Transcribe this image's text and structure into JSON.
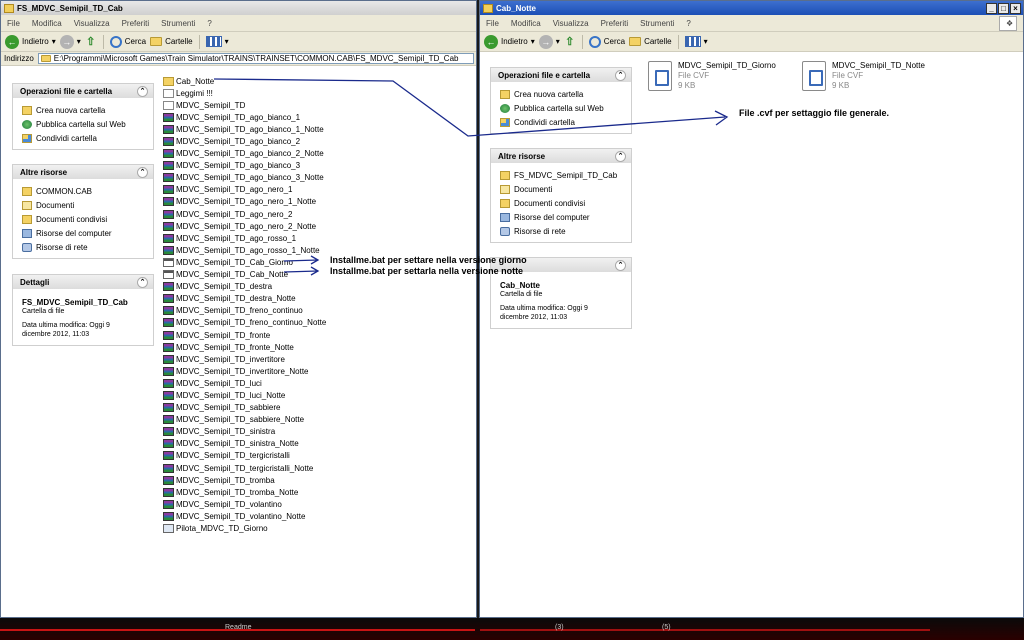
{
  "left_window": {
    "title": "FS_MDVC_Semipil_TD_Cab",
    "menu": [
      "File",
      "Modifica",
      "Visualizza",
      "Preferiti",
      "Strumenti",
      "?"
    ],
    "toolbar": {
      "back": "Indietro",
      "search": "Cerca",
      "folders": "Cartelle"
    },
    "address_label": "Indirizzo",
    "address": "E:\\Programmi\\Microsoft Games\\Train Simulator\\TRAINS\\TRAINSET\\COMMON.CAB\\FS_MDVC_Semipil_TD_Cab",
    "tasks": {
      "title": "Operazioni file e cartella",
      "items": [
        "Crea nuova cartella",
        "Pubblica cartella sul Web",
        "Condividi cartella"
      ]
    },
    "other": {
      "title": "Altre risorse",
      "items": [
        "COMMON.CAB",
        "Documenti",
        "Documenti condivisi",
        "Risorse del computer",
        "Risorse di rete"
      ]
    },
    "details": {
      "title": "Dettagli",
      "name": "FS_MDVC_Semipil_TD_Cab",
      "type": "Cartella di file",
      "modified_1": "Data ultima modifica: Oggi 9",
      "modified_2": "dicembre 2012, 11:03"
    },
    "files": [
      {
        "name": "Cab_Notte",
        "type": "folder"
      },
      {
        "name": "Leggimi !!!",
        "type": "txt"
      },
      {
        "name": "MDVC_Semipil_TD",
        "type": "txt"
      },
      {
        "name": "MDVC_Semipil_TD_ago_bianco_1",
        "type": "rar"
      },
      {
        "name": "MDVC_Semipil_TD_ago_bianco_1_Notte",
        "type": "rar"
      },
      {
        "name": "MDVC_Semipil_TD_ago_bianco_2",
        "type": "rar"
      },
      {
        "name": "MDVC_Semipil_TD_ago_bianco_2_Notte",
        "type": "rar"
      },
      {
        "name": "MDVC_Semipil_TD_ago_bianco_3",
        "type": "rar"
      },
      {
        "name": "MDVC_Semipil_TD_ago_bianco_3_Notte",
        "type": "rar"
      },
      {
        "name": "MDVC_Semipil_TD_ago_nero_1",
        "type": "rar"
      },
      {
        "name": "MDVC_Semipil_TD_ago_nero_1_Notte",
        "type": "rar"
      },
      {
        "name": "MDVC_Semipil_TD_ago_nero_2",
        "type": "rar"
      },
      {
        "name": "MDVC_Semipil_TD_ago_nero_2_Notte",
        "type": "rar"
      },
      {
        "name": "MDVC_Semipil_TD_ago_rosso_1",
        "type": "rar"
      },
      {
        "name": "MDVC_Semipil_TD_ago_rosso_1_Notte",
        "type": "rar"
      },
      {
        "name": "MDVC_Semipil_TD_Cab_Giorno",
        "type": "bat"
      },
      {
        "name": "MDVC_Semipil_TD_Cab_Notte",
        "type": "bat"
      },
      {
        "name": "MDVC_Semipil_TD_destra",
        "type": "rar"
      },
      {
        "name": "MDVC_Semipil_TD_destra_Notte",
        "type": "rar"
      },
      {
        "name": "MDVC_Semipil_TD_freno_continuo",
        "type": "rar"
      },
      {
        "name": "MDVC_Semipil_TD_freno_continuo_Notte",
        "type": "rar"
      },
      {
        "name": "MDVC_Semipil_TD_fronte",
        "type": "rar"
      },
      {
        "name": "MDVC_Semipil_TD_fronte_Notte",
        "type": "rar"
      },
      {
        "name": "MDVC_Semipil_TD_invertitore",
        "type": "rar"
      },
      {
        "name": "MDVC_Semipil_TD_invertitore_Notte",
        "type": "rar"
      },
      {
        "name": "MDVC_Semipil_TD_luci",
        "type": "rar"
      },
      {
        "name": "MDVC_Semipil_TD_luci_Notte",
        "type": "rar"
      },
      {
        "name": "MDVC_Semipil_TD_sabbiere",
        "type": "rar"
      },
      {
        "name": "MDVC_Semipil_TD_sabbiere_Notte",
        "type": "rar"
      },
      {
        "name": "MDVC_Semipil_TD_sinistra",
        "type": "rar"
      },
      {
        "name": "MDVC_Semipil_TD_sinistra_Notte",
        "type": "rar"
      },
      {
        "name": "MDVC_Semipil_TD_tergicristalli",
        "type": "rar"
      },
      {
        "name": "MDVC_Semipil_TD_tergicristalli_Notte",
        "type": "rar"
      },
      {
        "name": "MDVC_Semipil_TD_tromba",
        "type": "rar"
      },
      {
        "name": "MDVC_Semipil_TD_tromba_Notte",
        "type": "rar"
      },
      {
        "name": "MDVC_Semipil_TD_volantino",
        "type": "rar"
      },
      {
        "name": "MDVC_Semipil_TD_volantino_Notte",
        "type": "rar"
      },
      {
        "name": "Pilota_MDVC_TD_Giorno",
        "type": "lnk"
      }
    ]
  },
  "right_window": {
    "title": "Cab_Notte",
    "menu": [
      "File",
      "Modifica",
      "Visualizza",
      "Preferiti",
      "Strumenti",
      "?"
    ],
    "toolbar": {
      "back": "Indietro",
      "search": "Cerca",
      "folders": "Cartelle"
    },
    "tasks": {
      "title": "Operazioni file e cartella",
      "items": [
        "Crea nuova cartella",
        "Pubblica cartella sul Web",
        "Condividi cartella"
      ]
    },
    "other": {
      "title": "Altre risorse",
      "items": [
        "FS_MDVC_Semipil_TD_Cab",
        "Documenti",
        "Documenti condivisi",
        "Risorse del computer",
        "Risorse di rete"
      ]
    },
    "details": {
      "name": "Cab_Notte",
      "type": "Cartella di file",
      "modified_1": "Data ultima modifica: Oggi 9",
      "modified_2": "dicembre 2012, 11:03"
    },
    "files": [
      {
        "name": "MDVC_Semipil_TD_Giorno",
        "type": "File CVF",
        "size": "9 KB"
      },
      {
        "name": "MDVC_Semipil_TD_Notte",
        "type": "File CVF",
        "size": "9 KB"
      }
    ]
  },
  "annotations": {
    "cvf": "File .cvf per settaggio file generale.",
    "giorno": "Installme.bat per settare nella versione giorno",
    "notte": "Installme.bat per settarla nella versione notte"
  },
  "taskbar": {
    "item_readme": "Readme",
    "badge_1": "(3)",
    "badge_2": "(5)"
  }
}
